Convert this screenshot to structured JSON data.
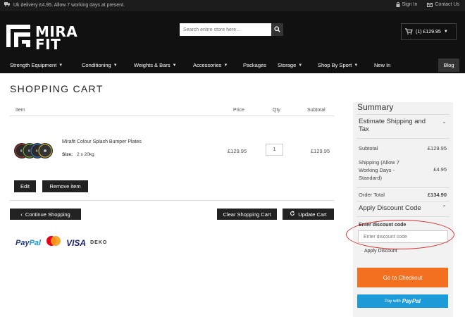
{
  "topbar": {
    "delivery": "Uk delivery £4.95. Allow 7 working days at present.",
    "sign_in": "Sign In",
    "contact": "Contact Us"
  },
  "logo": {
    "line1": "MIRA",
    "line2": "FIT"
  },
  "search": {
    "placeholder": "Search entire store here..."
  },
  "cart": {
    "label": "(1) £129.95"
  },
  "nav": {
    "items": [
      "Strength Equipment",
      "Conditioning",
      "Weights & Bars",
      "Accessories",
      "Packages",
      "Storage",
      "Shop By Sport",
      "New In"
    ],
    "blog": "Blog"
  },
  "page": {
    "title": "SHOPPING CART"
  },
  "table": {
    "headers": {
      "item": "Item",
      "price": "Price",
      "qty": "Qty",
      "subtotal": "Subtotal"
    },
    "row": {
      "name": "Mirafit Colour Splash Bumper Plates",
      "size_label": "Size:",
      "size_value": "2 x 20kg",
      "price": "£129.95",
      "qty": "1",
      "subtotal": "£129.95"
    },
    "edit": "Edit",
    "remove": "Remove item"
  },
  "actions": {
    "continue": "Continue Shopping",
    "clear": "Clear Shopping Cart",
    "update": "Update Cart"
  },
  "payments": {
    "paypal_a": "Pay",
    "paypal_b": "Pal",
    "visa": "VISA",
    "deko": "DEKO"
  },
  "summary": {
    "title": "Summary",
    "estimate": "Estimate Shipping and Tax",
    "subtotal_label": "Subtotal",
    "subtotal_value": "£129.95",
    "shipping_label": "Shipping (Allow 7 Working Days - Standard)",
    "shipping_value": "£4.95",
    "order_total_label": "Order Total",
    "order_total_value": "£134.90",
    "discount_title": "Apply Discount Code",
    "discount_label": "Enter discount code",
    "discount_placeholder": "Enter discount code",
    "apply": "Apply Discount",
    "checkout": "Go to Checkout",
    "paypal_pre": "Pay with",
    "paypal_brand": "PayPal"
  },
  "colors": {
    "checkout": "#f37021",
    "paypal_button": "#1c9bd8",
    "header": "#111111",
    "annotation": "#d63030"
  }
}
